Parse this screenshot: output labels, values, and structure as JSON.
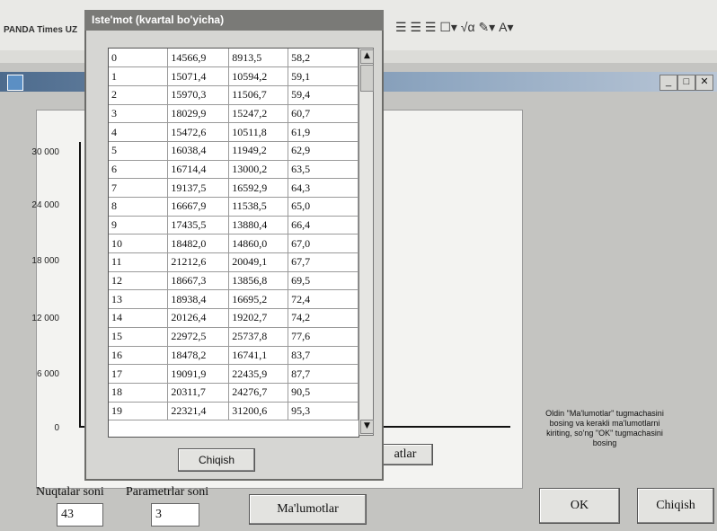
{
  "toolbar": {
    "font_name": "PANDA Times UZ"
  },
  "chart": {
    "y_ticks": [
      "30 000",
      "24 000",
      "18 000",
      "12 000",
      "6 000",
      "0"
    ]
  },
  "hint": "Oldin \"Ma'lumotlar\" tugmachasini bosing va kerakli ma'lumotlarni kiriting, so'ng \"OK\" tugmachasini bosing",
  "bottom": {
    "points_label": "Nuqtalar soni",
    "points_value": "43",
    "params_label": "Parametrlar soni",
    "params_value": "3",
    "data_button": "Ma'lumotlar",
    "ok_button": "OK",
    "exit_button": "Chiqish"
  },
  "dialog": {
    "title": "Iste'mot (kvartal bo'yicha)",
    "close_button": "Chiqish",
    "behind_button_fragment": "atlar",
    "rows": [
      [
        "0",
        "14566,9",
        "8913,5",
        "58,2"
      ],
      [
        "1",
        "15071,4",
        "10594,2",
        "59,1"
      ],
      [
        "2",
        "15970,3",
        "11506,7",
        "59,4"
      ],
      [
        "3",
        "18029,9",
        "15247,2",
        "60,7"
      ],
      [
        "4",
        "15472,6",
        "10511,8",
        "61,9"
      ],
      [
        "5",
        "16038,4",
        "11949,2",
        "62,9"
      ],
      [
        "6",
        "16714,4",
        "13000,2",
        "63,5"
      ],
      [
        "7",
        "19137,5",
        "16592,9",
        "64,3"
      ],
      [
        "8",
        "16667,9",
        "11538,5",
        "65,0"
      ],
      [
        "9",
        "17435,5",
        "13880,4",
        "66,4"
      ],
      [
        "10",
        "18482,0",
        "14860,0",
        "67,0"
      ],
      [
        "11",
        "21212,6",
        "20049,1",
        "67,7"
      ],
      [
        "12",
        "18667,3",
        "13856,8",
        "69,5"
      ],
      [
        "13",
        "18938,4",
        "16695,2",
        "72,4"
      ],
      [
        "14",
        "20126,4",
        "19202,7",
        "74,2"
      ],
      [
        "15",
        "22972,5",
        "25737,8",
        "77,6"
      ],
      [
        "16",
        "18478,2",
        "16741,1",
        "83,7"
      ],
      [
        "17",
        "19091,9",
        "22435,9",
        "87,7"
      ],
      [
        "18",
        "20311,7",
        "24276,7",
        "90,5"
      ],
      [
        "19",
        "22321,4",
        "31200,6",
        "95,3"
      ]
    ]
  }
}
